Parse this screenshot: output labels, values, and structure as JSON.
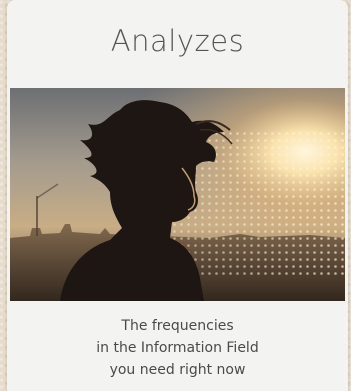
{
  "card": {
    "title": "Analyzes",
    "image_icon": "woman-silhouette-sunset-image",
    "caption_lines": [
      "The frequencies",
      "in the Information Field",
      "you need right now"
    ]
  },
  "colors": {
    "page_background": "#e6dccd",
    "card_background": "#f3f3f2",
    "title_text": "#555555",
    "caption_text": "#4a4a4a",
    "sun_glow": "#ffe7b0"
  }
}
